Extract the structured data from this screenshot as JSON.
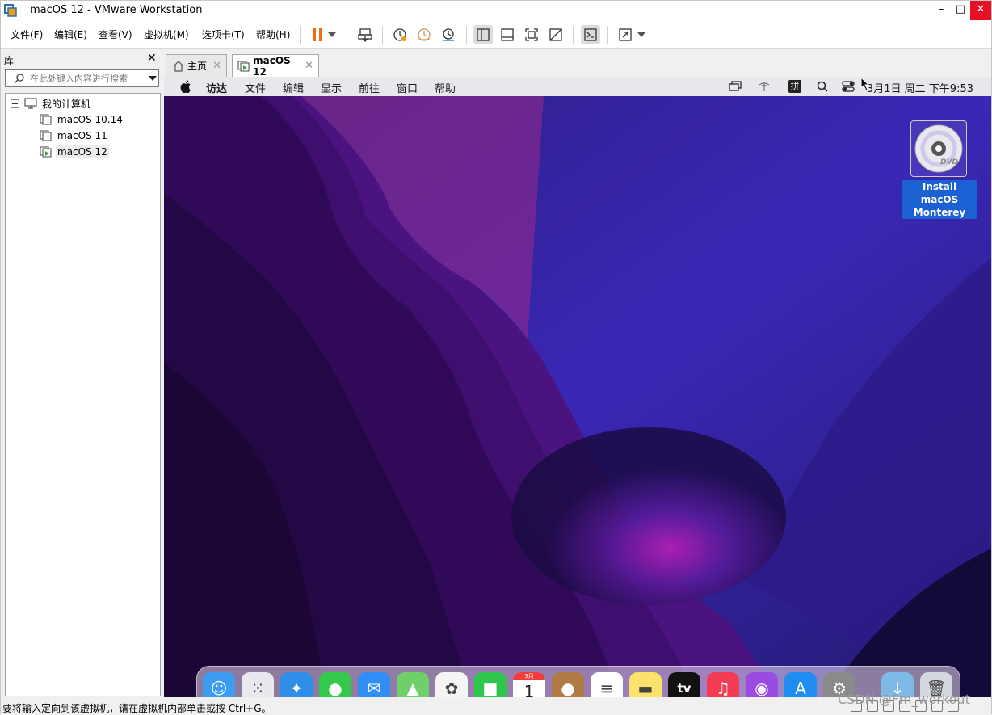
{
  "window": {
    "title": "macOS 12 - VMware Workstation",
    "minimize": "–",
    "maximize": "□",
    "close": "✕"
  },
  "menu": [
    "文件(F)",
    "编辑(E)",
    "查看(V)",
    "虚拟机(M)",
    "选项卡(T)",
    "帮助(H)"
  ],
  "toolbar": {
    "icons": [
      "pause-icon",
      "dropdown-icon",
      "send-ctrl-alt-del-icon",
      "snapshot-icon",
      "revert-snapshot-icon",
      "snapshot-manager-icon",
      "show-library-icon",
      "thumbnail-bar-icon",
      "full-screen-icon",
      "unity-icon",
      "console-view-icon",
      "stretch-icon",
      "stretch-dropdown-icon"
    ]
  },
  "library": {
    "title": "库",
    "close": "✕",
    "search_placeholder": "在此处键入内容进行搜索",
    "tree": {
      "root": "我的计算机",
      "items": [
        "macOS 10.14",
        "macOS 11",
        "macOS 12"
      ],
      "selected": "macOS 12"
    }
  },
  "tabs": [
    {
      "label": "主页",
      "close": "✕"
    },
    {
      "label": "macOS 12",
      "close": "✕"
    }
  ],
  "mac": {
    "menubar": [
      "访达",
      "文件",
      "编辑",
      "显示",
      "前往",
      "窗口",
      "帮助"
    ],
    "input_method": "拼",
    "clock": "3月1日 周二 下午9:53",
    "desktop_item": {
      "label_line1": "Install macOS",
      "label_line2": "Monterey",
      "badge": "DVD"
    },
    "dock": [
      {
        "name": "finder",
        "color": "#3b9cf0",
        "glyph": "☺"
      },
      {
        "name": "launchpad",
        "color": "#e8e8ee",
        "glyph": "⁙"
      },
      {
        "name": "safari",
        "color": "#2f8fe8",
        "glyph": "✦"
      },
      {
        "name": "messages",
        "color": "#33c94a",
        "glyph": "●"
      },
      {
        "name": "mail",
        "color": "#2f8ff4",
        "glyph": "✉"
      },
      {
        "name": "maps",
        "color": "#6fcf6a",
        "glyph": "▲"
      },
      {
        "name": "photos",
        "color": "#f5f5f5",
        "glyph": "✿"
      },
      {
        "name": "facetime",
        "color": "#2fc64e",
        "glyph": "■"
      },
      {
        "name": "calendar",
        "color": "#ffffff",
        "glyph": "1",
        "badge": "3月"
      },
      {
        "name": "contacts",
        "color": "#b07a43",
        "glyph": "●"
      },
      {
        "name": "reminders",
        "color": "#ffffff",
        "glyph": "≡"
      },
      {
        "name": "notes",
        "color": "#fbe26a",
        "glyph": "▬"
      },
      {
        "name": "tv",
        "color": "#111111",
        "glyph": "tv"
      },
      {
        "name": "music",
        "color": "#f43c55",
        "glyph": "♫"
      },
      {
        "name": "podcasts",
        "color": "#9a4ce0",
        "glyph": "◉"
      },
      {
        "name": "app-store",
        "color": "#1f8cf0",
        "glyph": "A"
      },
      {
        "name": "system-preferences",
        "color": "#8a8a8a",
        "glyph": "⚙"
      },
      {
        "name": "downloads",
        "color": "#7fb9e6",
        "glyph": "↓"
      },
      {
        "name": "trash",
        "color": "#d5d8de",
        "glyph": "🗑"
      }
    ]
  },
  "status": {
    "text": "要将输入定向到该虚拟机，请在虚拟机内部单击或按 Ctrl+G。",
    "watermark": "CSDN @Fm_workout"
  }
}
